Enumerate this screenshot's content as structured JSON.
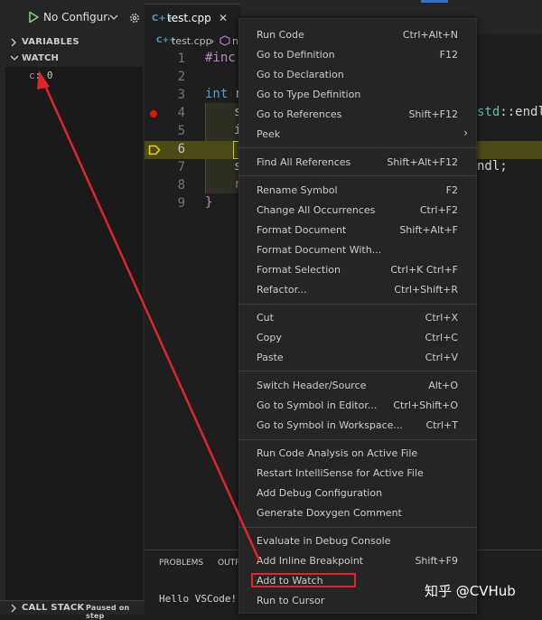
{
  "debug": {
    "configuration": "No Configurati",
    "sections": {
      "variables": "VARIABLES",
      "watch": "WATCH",
      "call_stack": "CALL STACK",
      "call_stack_status": "Paused on step"
    },
    "watch_items": [
      {
        "name": "c",
        "value": "0"
      }
    ]
  },
  "editor": {
    "tab_icon": "C++",
    "tab_label": "test.cpp",
    "tab_close": "✕",
    "breadcrumb": {
      "file": "test.cpp",
      "symbol": "n"
    },
    "current_line": 6,
    "breakpoint_line": 4,
    "line_numbers": [
      "1",
      "2",
      "3",
      "4",
      "5",
      "6",
      "7",
      "8",
      "9"
    ],
    "code": {
      "l1": "#inc",
      "l3_kw": "int",
      "l3_rest": " n",
      "l4_frag": "s",
      "l4_right_ns": "std",
      "l4_right": "::endl",
      "l5_frag": "i",
      "l7_frag": "s",
      "l7_right": "ndl;",
      "l8_frag": "r",
      "l9": "}"
    }
  },
  "bottom_panel": {
    "tabs": [
      "PROBLEMS",
      "OUTP"
    ],
    "terminal_output": "Hello VSCode!"
  },
  "context_menu": {
    "items": [
      {
        "label": "Run Code",
        "shortcut": "Ctrl+Alt+N"
      },
      {
        "label": "Go to Definition",
        "shortcut": "F12"
      },
      {
        "label": "Go to Declaration",
        "shortcut": ""
      },
      {
        "label": "Go to Type Definition",
        "shortcut": ""
      },
      {
        "label": "Go to References",
        "shortcut": "Shift+F12"
      },
      {
        "label": "Peek",
        "shortcut": "",
        "submenu": "›"
      },
      {
        "label": "Find All References",
        "shortcut": "Shift+Alt+F12"
      },
      {
        "label": "Rename Symbol",
        "shortcut": "F2"
      },
      {
        "label": "Change All Occurrences",
        "shortcut": "Ctrl+F2"
      },
      {
        "label": "Format Document",
        "shortcut": "Shift+Alt+F"
      },
      {
        "label": "Format Document With...",
        "shortcut": ""
      },
      {
        "label": "Format Selection",
        "shortcut": "Ctrl+K Ctrl+F"
      },
      {
        "label": "Refactor...",
        "shortcut": "Ctrl+Shift+R"
      },
      {
        "label": "Cut",
        "shortcut": "Ctrl+X"
      },
      {
        "label": "Copy",
        "shortcut": "Ctrl+C"
      },
      {
        "label": "Paste",
        "shortcut": "Ctrl+V"
      },
      {
        "label": "Switch Header/Source",
        "shortcut": "Alt+O"
      },
      {
        "label": "Go to Symbol in Editor...",
        "shortcut": "Ctrl+Shift+O"
      },
      {
        "label": "Go to Symbol in Workspace...",
        "shortcut": "Ctrl+T"
      },
      {
        "label": "Run Code Analysis on Active File",
        "shortcut": ""
      },
      {
        "label": "Restart IntelliSense for Active File",
        "shortcut": ""
      },
      {
        "label": "Add Debug Configuration",
        "shortcut": ""
      },
      {
        "label": "Generate Doxygen Comment",
        "shortcut": ""
      },
      {
        "label": "Evaluate in Debug Console",
        "shortcut": ""
      },
      {
        "label": "Add Inline Breakpoint",
        "shortcut": "Shift+F9"
      },
      {
        "label": "Add to Watch",
        "shortcut": ""
      },
      {
        "label": "Run to Cursor",
        "shortcut": ""
      }
    ]
  },
  "watermark": "知乎 @CVHub",
  "colors": {
    "annotation": "#e0252e",
    "breakpoint": "#e51400",
    "current_line": "#4b4b18"
  },
  "icons": [
    "run-icon",
    "chevron-down-icon",
    "gear-icon",
    "chevron-right-icon",
    "symbol-method-icon",
    "breakpoint-icon",
    "execution-pointer-icon",
    "submenu-chevron-icon"
  ]
}
